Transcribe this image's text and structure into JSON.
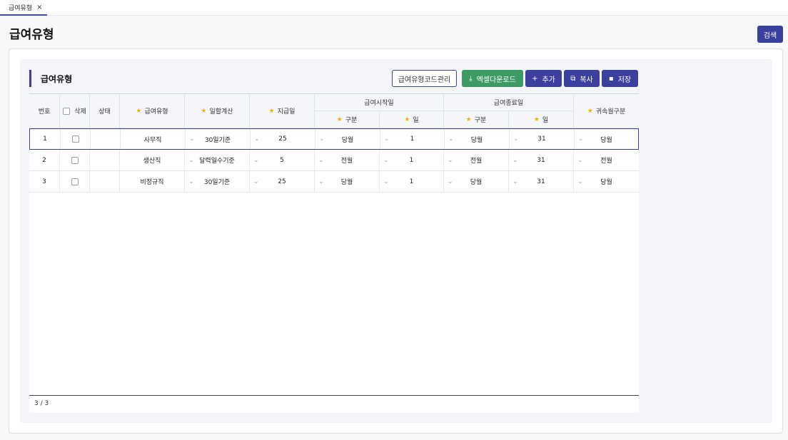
{
  "tabs": [
    {
      "label": "급여유형",
      "close": "×"
    }
  ],
  "page_title": "급여유형",
  "buttons": {
    "search": "검색",
    "code_manage": "급여유형코드관리",
    "excel": "엑셀다운로드",
    "add": "추가",
    "copy": "복사",
    "save": "저장"
  },
  "icons": {
    "excel": "download-icon",
    "add": "plus-icon",
    "copy": "copy-icon",
    "save": "save-icon"
  },
  "section_title": "급여유형",
  "headers": {
    "no": "번호",
    "delete": "삭제",
    "status": "상태",
    "pay_type": "급여유형",
    "daily_calc": "일할계산",
    "pay_day": "지급일",
    "start_group": "급여시작일",
    "start_div": "구분",
    "start_day": "일",
    "end_group": "급여종료일",
    "end_div": "구분",
    "end_day": "일",
    "attr_month": "귀속월구분"
  },
  "rows": [
    {
      "no": "1",
      "status": "",
      "pay_type": "사무직",
      "daily_calc": "30일기준",
      "pay_day": "25",
      "start_div": "당월",
      "start_day": "1",
      "end_div": "당월",
      "end_day": "31",
      "attr_month": "당월"
    },
    {
      "no": "2",
      "status": "",
      "pay_type": "생산직",
      "daily_calc": "달력일수기준",
      "pay_day": "5",
      "start_div": "전월",
      "start_day": "1",
      "end_div": "전월",
      "end_day": "31",
      "attr_month": "전월"
    },
    {
      "no": "3",
      "status": "",
      "pay_type": "비정규직",
      "daily_calc": "30일기준",
      "pay_day": "25",
      "start_div": "당월",
      "start_day": "1",
      "end_div": "당월",
      "end_day": "31",
      "attr_month": "당월"
    }
  ],
  "footer_count": "3 / 3",
  "colors": {
    "primary": "#3b3f9e",
    "excel": "#3d9a63",
    "star": "#f0b400"
  }
}
